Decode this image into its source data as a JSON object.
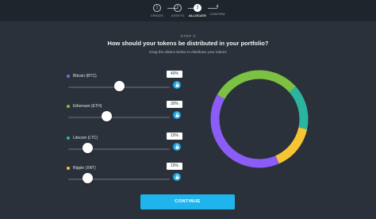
{
  "stepper": {
    "steps": [
      {
        "number": "1",
        "label": "CREATE",
        "state": "done"
      },
      {
        "number": "2",
        "label": "ASSETS",
        "state": "done"
      },
      {
        "number": "3",
        "label": "ALLOCATE",
        "state": "active"
      },
      {
        "number": "4",
        "label": "CONFIRM",
        "state": "future"
      }
    ]
  },
  "header": {
    "eyebrow": "STEP 3",
    "title": "How should your tokens be distributed in your portfolio?",
    "subtitle": "Drag the sliders below to distribute your tokens"
  },
  "coins": [
    {
      "name": "Bitcoin (BTC)",
      "percent_label": "40%",
      "value": 0.4,
      "color": "#8b5cf6"
    },
    {
      "name": "Ethereum (ETH)",
      "percent_label": "30%",
      "value": 0.3,
      "color": "#7dc142"
    },
    {
      "name": "Litecoin (LTC)",
      "percent_label": "15%",
      "value": 0.15,
      "color": "#2bb5a0"
    },
    {
      "name": "Ripple (XRT)",
      "percent_label": "15%",
      "value": 0.15,
      "color": "#f7c531"
    }
  ],
  "continue_label": "CONTINUE",
  "icons": {
    "lock": "lock-icon"
  }
}
